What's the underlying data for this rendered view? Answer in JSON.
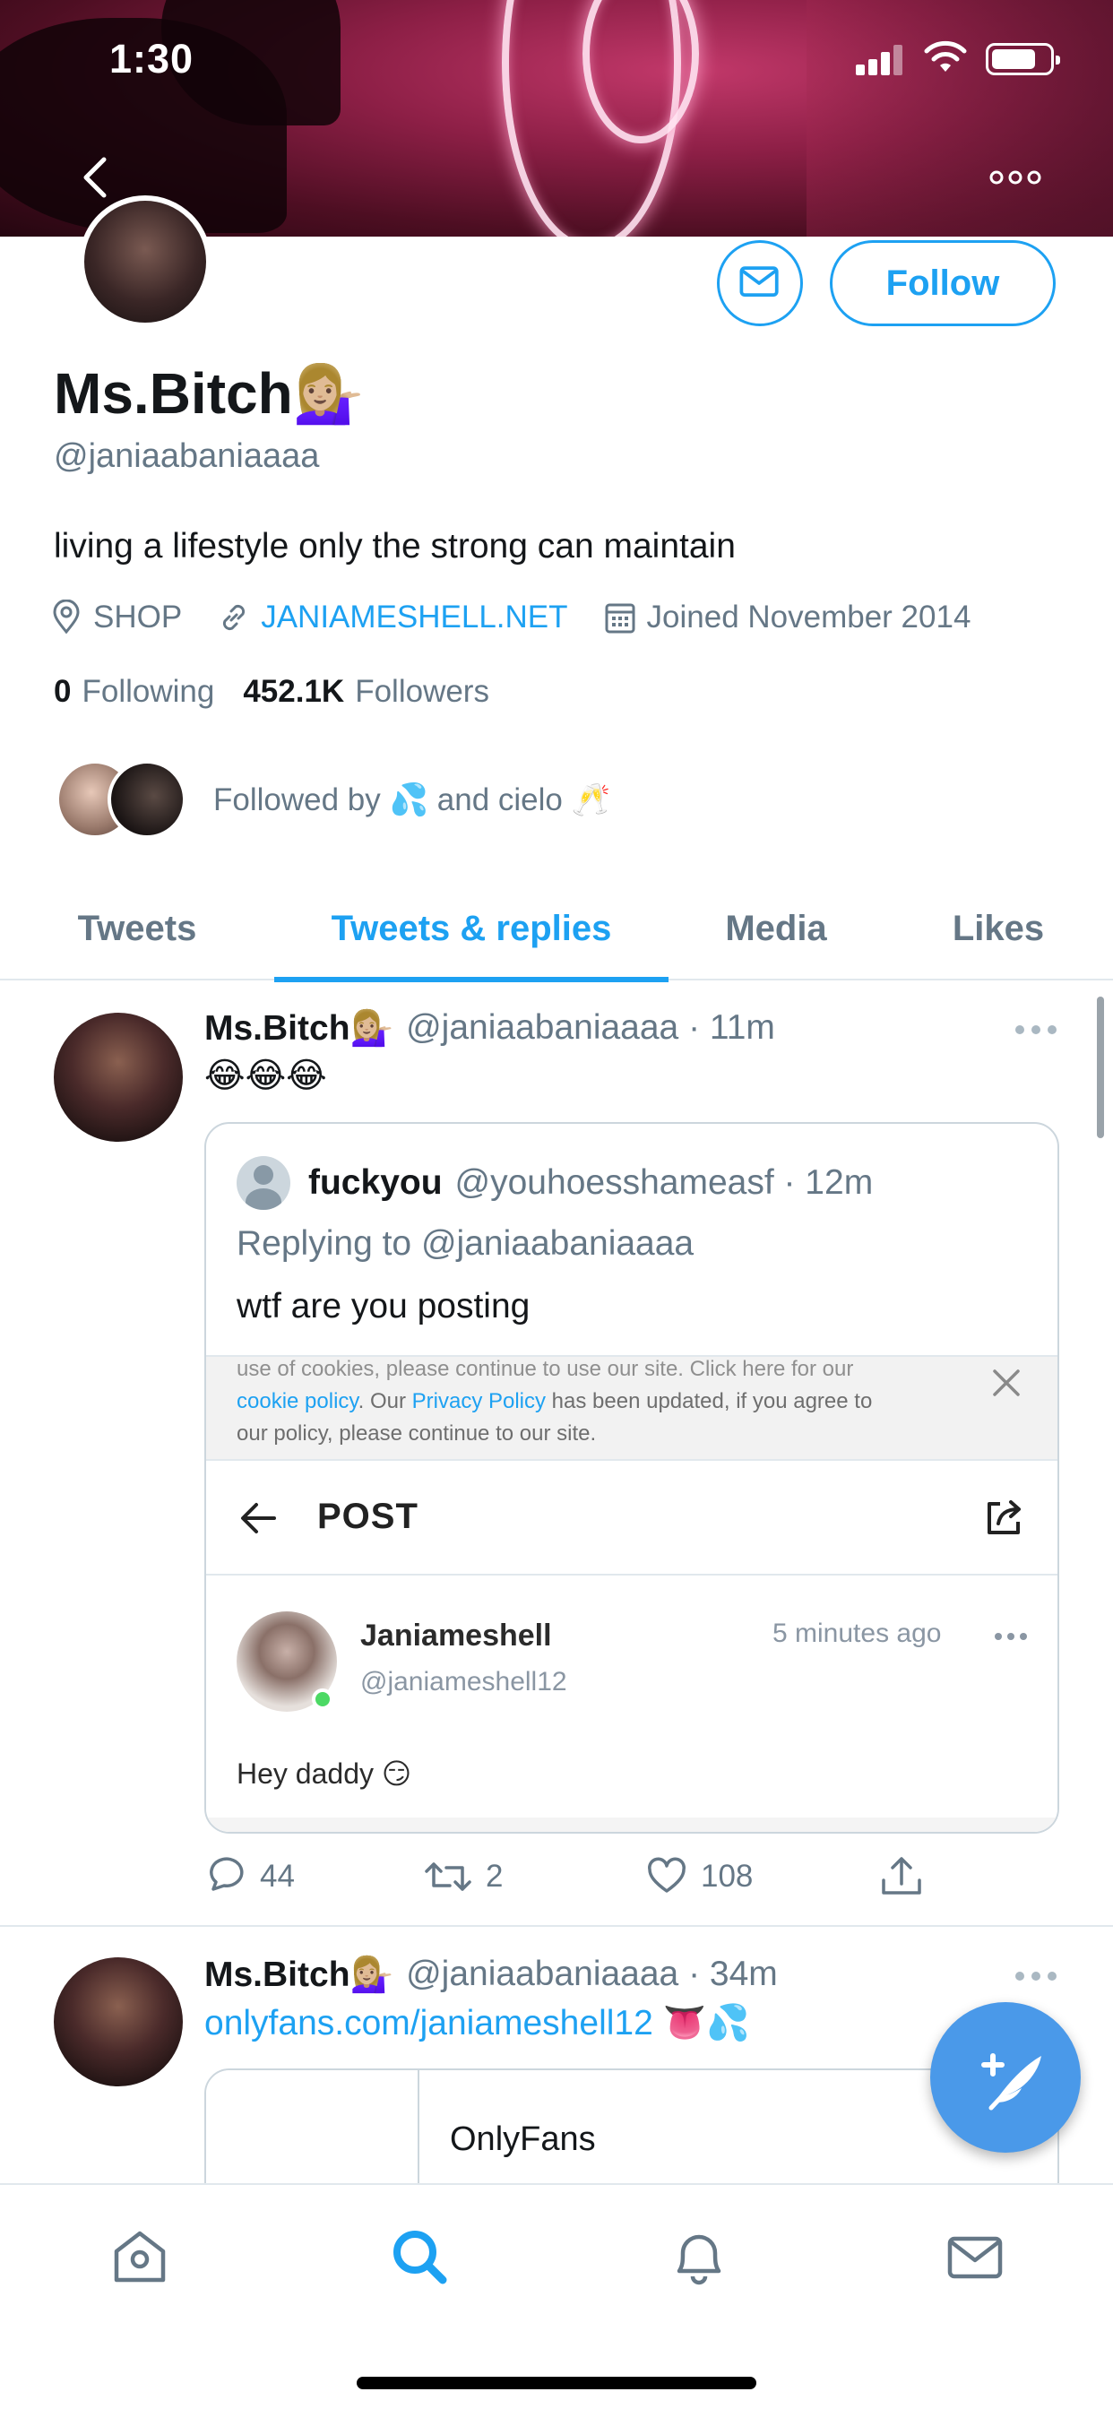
{
  "status_bar": {
    "time": "1:30"
  },
  "profile": {
    "display_name": "Ms.Bitch💁🏼‍♀️",
    "handle": "@janiaabaniaaaa",
    "bio": "living a lifestyle only the strong can maintain",
    "location": "SHOP",
    "website": "JANIAMESHELL.NET",
    "joined": "Joined November 2014",
    "following_count": "0",
    "following_label": "Following",
    "followers_count": "452.1K",
    "followers_label": "Followers",
    "followed_by": "Followed by 💦 and cielo 🥂",
    "follow_label": "Follow"
  },
  "tabs": [
    {
      "label": "Tweets",
      "active": false
    },
    {
      "label": "Tweets & replies",
      "active": true
    },
    {
      "label": "Media",
      "active": false
    },
    {
      "label": "Likes",
      "active": false
    }
  ],
  "tweets": [
    {
      "name": "Ms.Bitch💁🏼‍♀️",
      "handle_time": "@janiaabaniaaaa · 11m",
      "text": "😂😂😂",
      "quote": {
        "name": "fuckyou",
        "handle_time": "@youhoesshameasf · 12m",
        "replying_to": "Replying to @janiaabaniaaaa",
        "text": "wtf are you posting",
        "screenshot": {
          "cookie_line1": "use of cookies, please continue to use our site. Click here for our",
          "cookie_policy": "cookie policy",
          "cookie_mid": ". Our ",
          "privacy_policy": "Privacy Policy",
          "cookie_tail": " has been updated, if you agree to",
          "cookie_line3": "our policy, please continue to our site.",
          "post_title": "POST",
          "author": "Janiameshell",
          "author_handle": "@janiameshell12",
          "time_ago": "5 minutes ago",
          "post_text": "Hey daddy 😏"
        }
      },
      "replies": "44",
      "retweets": "2",
      "likes": "108"
    },
    {
      "name": "Ms.Bitch💁🏼‍♀️",
      "handle_time": "@janiaabaniaaaa · 34m",
      "link": "onlyfans.com/janiameshell12",
      "emoji": " 👅💦",
      "card_title": "OnlyFans"
    }
  ],
  "colors": {
    "accent": "#1da1f2",
    "text": "#14171a",
    "secondary": "#657786",
    "divider": "#e1e8ed"
  },
  "icons": [
    "back-icon",
    "more-icon",
    "mail-icon",
    "location-icon",
    "link-icon",
    "calendar-icon",
    "reply-icon",
    "retweet-icon",
    "like-icon",
    "share-icon",
    "home-icon",
    "search-icon",
    "bell-icon",
    "messages-icon",
    "compose-icon"
  ]
}
